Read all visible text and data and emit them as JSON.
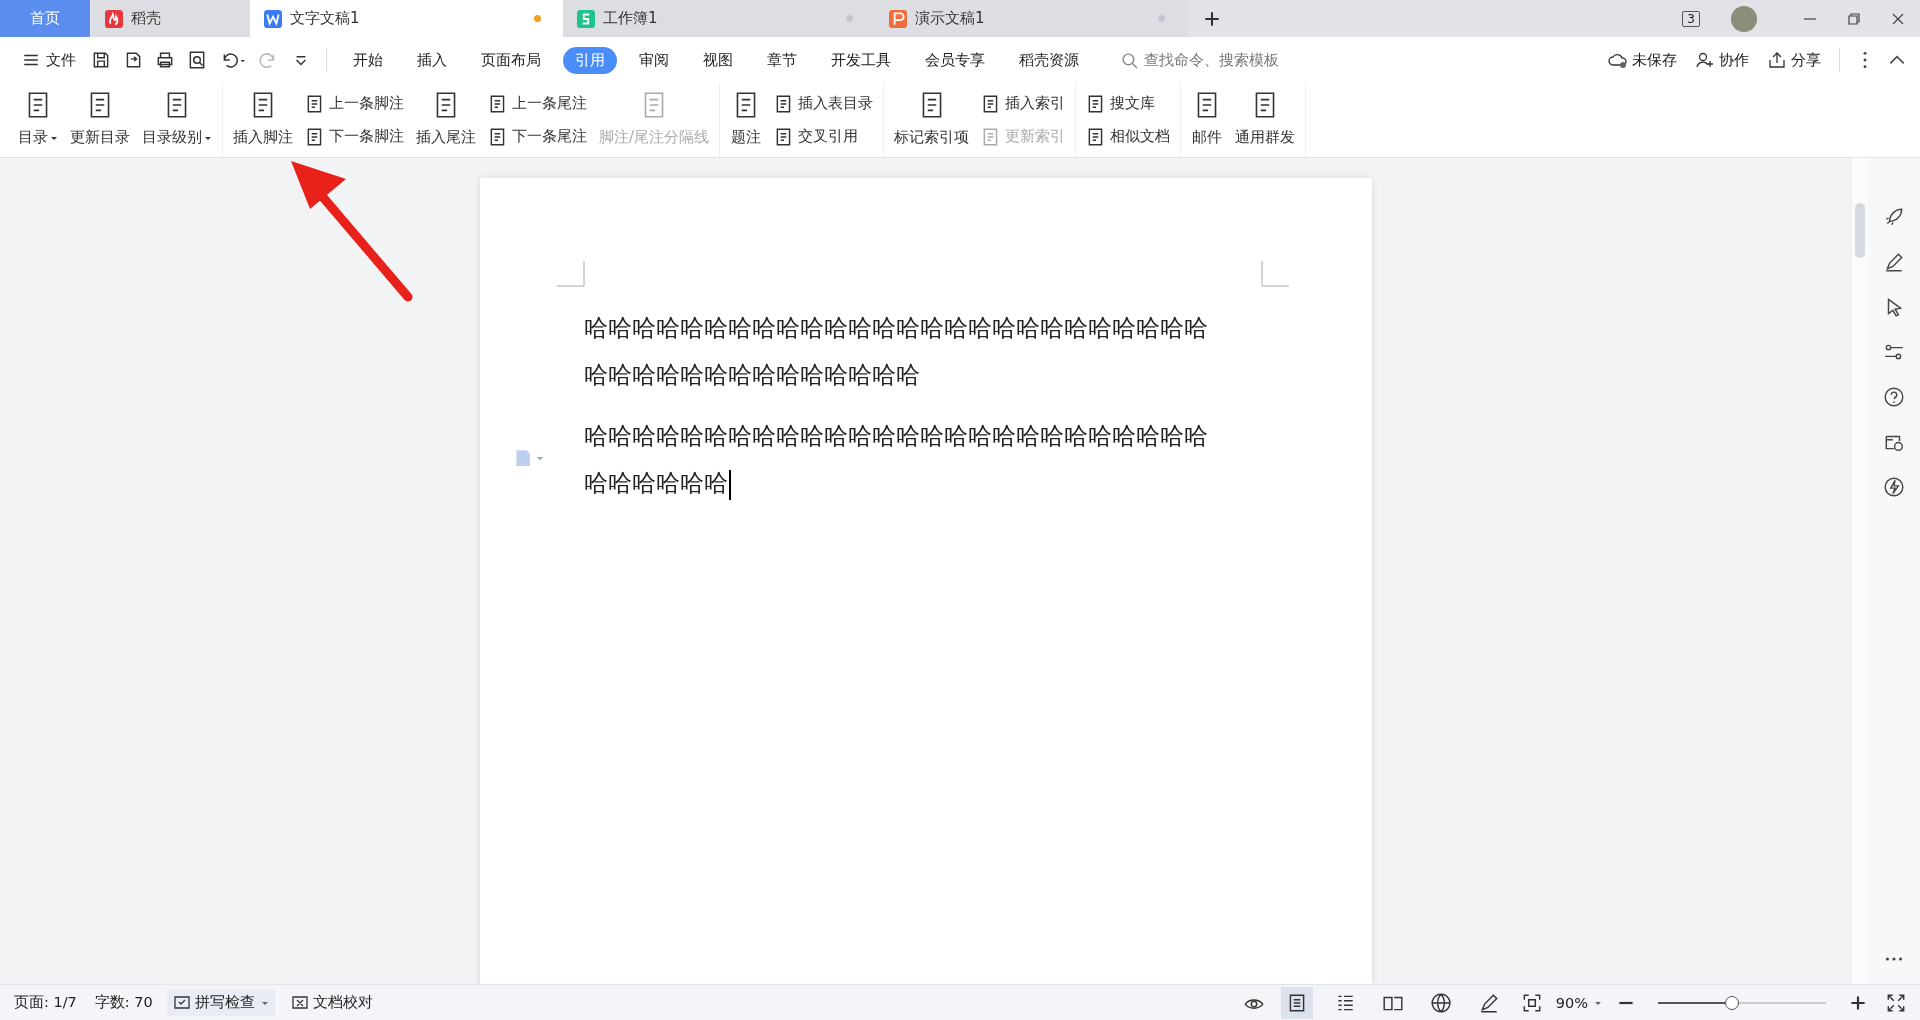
{
  "tabs": [
    {
      "label": "首页",
      "kind": "home",
      "selected": false
    },
    {
      "label": "稻壳",
      "kind": "docer",
      "selected": false
    },
    {
      "label": "文字文稿1",
      "kind": "writer",
      "selected": true,
      "modified": true
    },
    {
      "label": "工作簿1",
      "kind": "sheet",
      "selected": false,
      "modified": false
    },
    {
      "label": "演示文稿1",
      "kind": "slides",
      "selected": false,
      "modified": false
    }
  ],
  "window_count": "3",
  "menu": {
    "file": "文件",
    "items": [
      {
        "label": "开始",
        "selected": false
      },
      {
        "label": "插入",
        "selected": false
      },
      {
        "label": "页面布局",
        "selected": false
      },
      {
        "label": "引用",
        "selected": true
      },
      {
        "label": "审阅",
        "selected": false
      },
      {
        "label": "视图",
        "selected": false
      },
      {
        "label": "章节",
        "selected": false
      },
      {
        "label": "开发工具",
        "selected": false
      },
      {
        "label": "会员专享",
        "selected": false
      },
      {
        "label": "稻壳资源",
        "selected": false
      }
    ],
    "search": {
      "placeholder": "查找命令、搜索模板"
    },
    "actions": [
      "未保存",
      "协作",
      "分享"
    ]
  },
  "ribbon": [
    {
      "items": [
        {
          "kind": "large",
          "label": "目录",
          "dropdown": true,
          "disabled": false
        },
        {
          "kind": "large",
          "label": "更新目录",
          "dropdown": false,
          "disabled": false
        },
        {
          "kind": "large",
          "label": "目录级别",
          "dropdown": true,
          "disabled": false
        }
      ]
    },
    {
      "items": [
        {
          "kind": "large",
          "label": "插入脚注",
          "dropdown": false,
          "disabled": false
        },
        {
          "kind": "stack",
          "buttons": [
            {
              "label": "上一条脚注",
              "disabled": false
            },
            {
              "label": "下一条脚注",
              "disabled": false
            }
          ]
        },
        {
          "kind": "large",
          "label": "插入尾注",
          "dropdown": false,
          "disabled": false
        },
        {
          "kind": "stack",
          "buttons": [
            {
              "label": "上一条尾注",
              "disabled": false
            },
            {
              "label": "下一条尾注",
              "disabled": false
            }
          ]
        },
        {
          "kind": "large",
          "label": "脚注/尾注分隔线",
          "dropdown": false,
          "disabled": true
        }
      ]
    },
    {
      "items": [
        {
          "kind": "large",
          "label": "题注",
          "dropdown": false,
          "disabled": false
        },
        {
          "kind": "stack",
          "buttons": [
            {
              "label": "插入表目录",
              "disabled": false
            },
            {
              "label": "交叉引用",
              "disabled": false
            }
          ]
        }
      ]
    },
    {
      "items": [
        {
          "kind": "large",
          "label": "标记索引项",
          "dropdown": false,
          "disabled": false
        },
        {
          "kind": "stack",
          "buttons": [
            {
              "label": "插入索引",
              "disabled": false
            },
            {
              "label": "更新索引",
              "disabled": true
            }
          ]
        }
      ]
    },
    {
      "items": [
        {
          "kind": "stack",
          "buttons": [
            {
              "label": "搜文库",
              "disabled": false
            },
            {
              "label": "相似文档",
              "disabled": false
            }
          ]
        }
      ]
    },
    {
      "items": [
        {
          "kind": "large",
          "label": "邮件",
          "dropdown": false,
          "disabled": false
        },
        {
          "kind": "large",
          "label": "通用群发",
          "dropdown": false,
          "disabled": false
        }
      ]
    }
  ],
  "document": {
    "paragraphs": [
      "哈哈哈哈哈哈哈哈哈哈哈哈哈哈哈哈哈哈哈哈哈哈哈哈哈哈哈哈哈哈哈哈哈哈哈哈哈哈哈哈",
      "哈哈哈哈哈哈哈哈哈哈哈哈哈哈哈哈哈哈哈哈哈哈哈哈哈哈哈哈哈哈哈哈"
    ]
  },
  "status_bar": {
    "page": "页面: 1/7",
    "words": "字数: 70",
    "spell_check": "拼写检查",
    "proofread": "文档校对",
    "views": [
      {
        "selected": true
      },
      {
        "selected": false
      },
      {
        "selected": false
      },
      {
        "selected": false
      },
      {
        "selected": false
      }
    ],
    "zoom": "90%",
    "zoom_slider": {
      "level": 0.44
    }
  }
}
